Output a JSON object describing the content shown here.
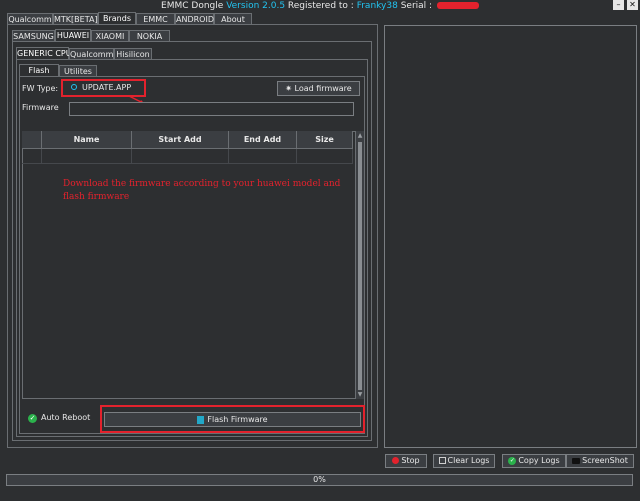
{
  "titlebar": {
    "app_name": "EMMC Dongle",
    "version": "Version 2.0.5",
    "registered_label": "Registered to :",
    "user": "Franky38",
    "serial_label": "Serial :",
    "minimize": "–",
    "close": "✕"
  },
  "main_tabs": [
    "Qualcomm",
    "MTK[BETA]",
    "Brands",
    "EMMC",
    "ANDROID",
    "About"
  ],
  "brand_tabs": [
    "SAMSUNG",
    "HUAWEI",
    "XIAOMI",
    "NOKIA"
  ],
  "huawei_tabs": [
    "GENERIC CPU",
    "Qualcomm",
    "Hisilicon"
  ],
  "sub_tabs": [
    "Flash",
    "Utilites"
  ],
  "fw_type": {
    "label": "FW Type:",
    "option": "UPDATE.APP"
  },
  "load_firmware": "Load firmware",
  "firmware": {
    "label": "Firmware",
    "value": ""
  },
  "table": {
    "headers": [
      "Name",
      "Start Add",
      "End Add",
      "Size"
    ]
  },
  "note": "Download the firmware according to your huawei model and flash firmware",
  "auto_reboot": "Auto Reboot",
  "flash_firmware": "Flash Firmware",
  "log_buttons": {
    "stop": "Stop",
    "clear_logs": "Clear Logs",
    "copy_logs": "Copy Logs",
    "screenshot": "ScreenShot"
  },
  "progress": {
    "value": 0,
    "label": "0%"
  },
  "colors": {
    "accent": "#22c3f0",
    "annotation": "#e3222d",
    "background": "#2d2f31"
  }
}
